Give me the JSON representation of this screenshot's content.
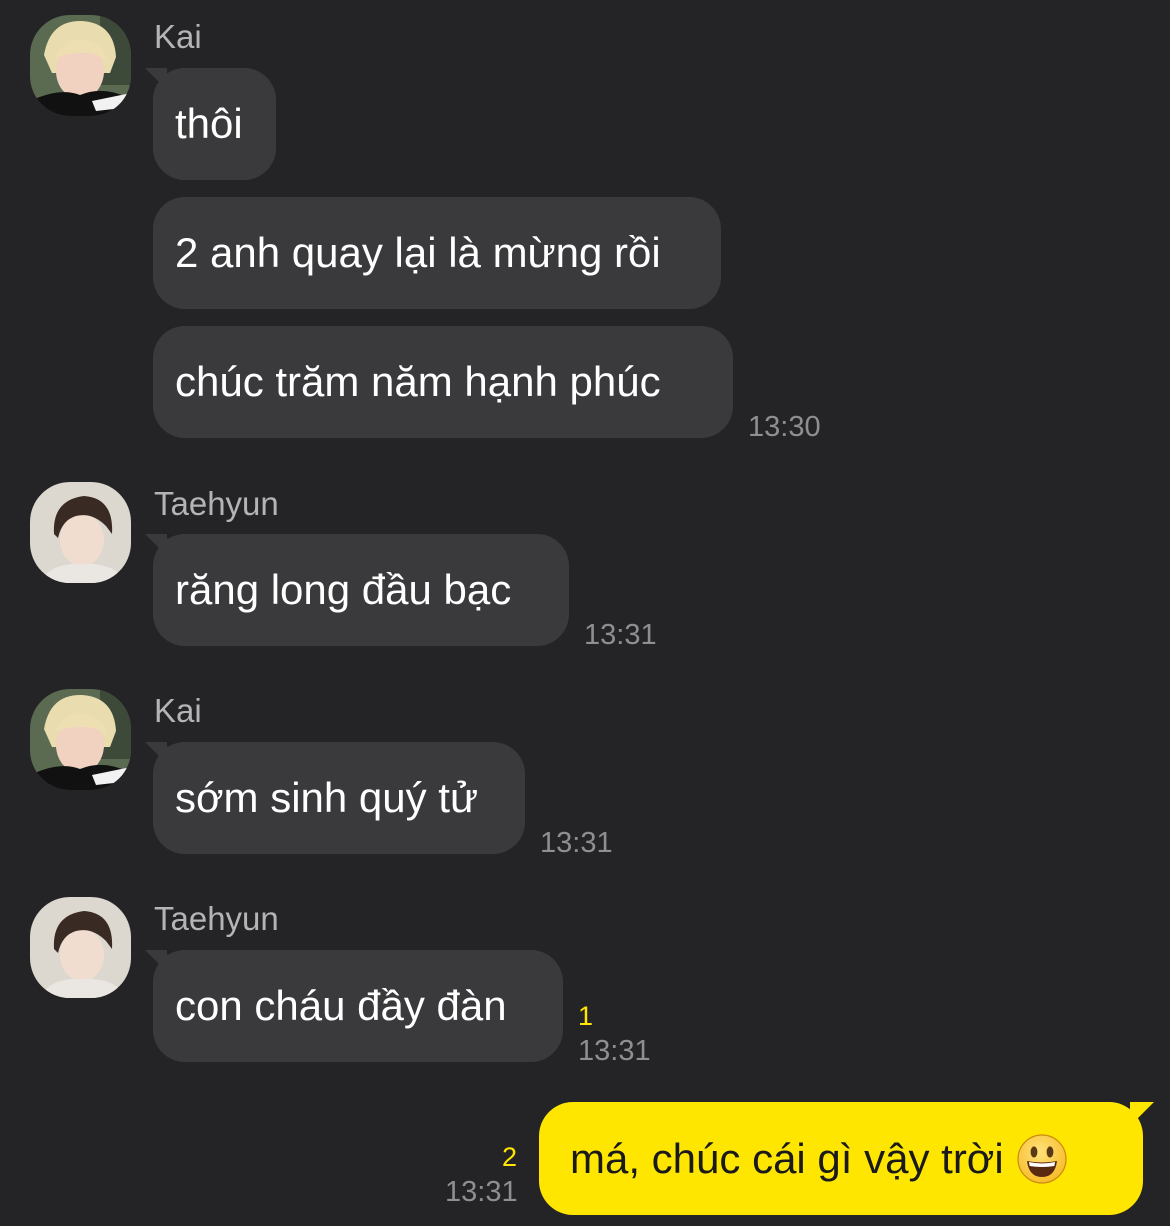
{
  "messages": [
    {
      "sender": "Kai",
      "avatar": "kai-avatar",
      "bubbles": [
        "thôi",
        "2 anh quay lại là mừng rồi",
        "chúc trăm năm hạnh phúc"
      ],
      "time": "13:30"
    },
    {
      "sender": "Taehyun",
      "avatar": "taehyun-avatar",
      "bubbles": [
        "răng long đầu bạc"
      ],
      "time": "13:31"
    },
    {
      "sender": "Kai",
      "avatar": "kai-avatar",
      "bubbles": [
        "sớm sinh quý tử"
      ],
      "time": "13:31"
    },
    {
      "sender": "Taehyun",
      "avatar": "taehyun-avatar",
      "bubbles": [
        "con cháu đầy đàn"
      ],
      "time": "13:31",
      "unread": "1"
    }
  ],
  "my_message": {
    "text": "má, chúc cái gì vậy trời",
    "emoji": "grinning-face-emoji",
    "time": "13:31",
    "unread": "2"
  },
  "colors": {
    "background": "#242426",
    "incoming_bubble": "#3a3a3c",
    "outgoing_bubble": "#ffe600",
    "unread_count": "#ffe500",
    "timestamp": "#8e8e93"
  }
}
